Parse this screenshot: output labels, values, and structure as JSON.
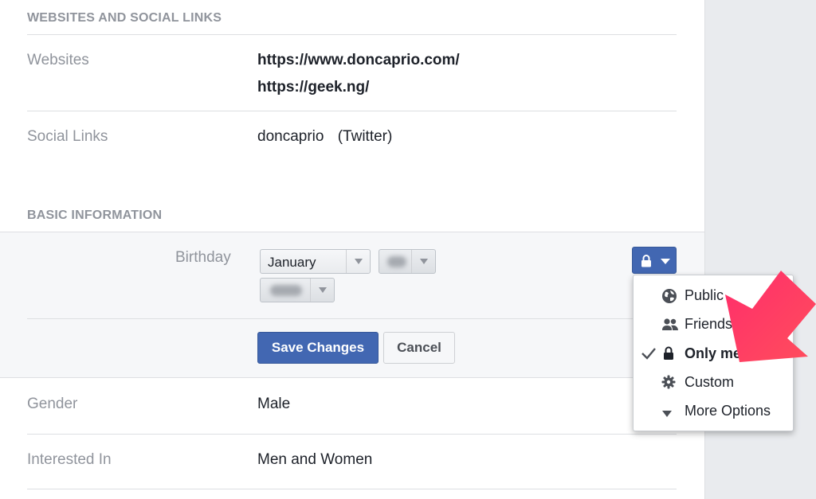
{
  "sections": {
    "websites_social": {
      "heading": "WEBSITES AND SOCIAL LINKS"
    },
    "basic_info": {
      "heading": "BASIC INFORMATION"
    }
  },
  "websites": {
    "label": "Websites",
    "urls": [
      "https://www.doncaprio.com/",
      "https://geek.ng/"
    ]
  },
  "social_links": {
    "label": "Social Links",
    "handle": "doncaprio",
    "network": "(Twitter)"
  },
  "birthday": {
    "label": "Birthday",
    "month": "January",
    "day_hidden": true,
    "year_hidden": true
  },
  "actions": {
    "save_label": "Save Changes",
    "cancel_label": "Cancel"
  },
  "gender": {
    "label": "Gender",
    "value": "Male"
  },
  "interested_in": {
    "label": "Interested In",
    "value": "Men and Women"
  },
  "privacy_menu": {
    "selected": "Only me",
    "items": [
      {
        "label": "Public",
        "icon": "globe-icon"
      },
      {
        "label": "Friends",
        "icon": "friends-icon"
      },
      {
        "label": "Only me",
        "icon": "lock-icon"
      },
      {
        "label": "Custom",
        "icon": "gear-icon"
      },
      {
        "label": "More Options",
        "icon": "caret-down-icon"
      }
    ]
  },
  "colors": {
    "primary_blue": "#4267b2",
    "annotation_arrow": "#ff3d6e"
  }
}
